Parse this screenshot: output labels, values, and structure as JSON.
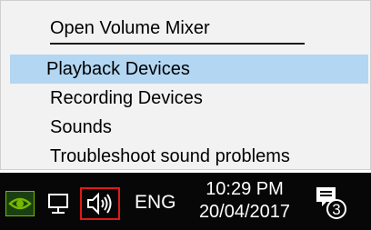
{
  "menu": {
    "items": [
      {
        "label": "Open Volume Mixer",
        "selected": false
      },
      {
        "label": "Playback Devices",
        "selected": true
      },
      {
        "label": "Recording Devices",
        "selected": false
      },
      {
        "label": "Sounds",
        "selected": false
      },
      {
        "label": "Troubleshoot sound problems",
        "selected": false
      }
    ]
  },
  "taskbar": {
    "tray_icons": [
      "nvidia-icon",
      "network-icon",
      "volume-icon"
    ],
    "language": "ENG",
    "time": "10:29 PM",
    "date": "20/04/2017",
    "notifications_count": "3"
  },
  "colors": {
    "selection": "#b3d6f2",
    "menu_background": "#f2f2f2",
    "taskbar": "#070707",
    "volume_highlight": "#e11919",
    "nvidia_green": "#76b900"
  }
}
